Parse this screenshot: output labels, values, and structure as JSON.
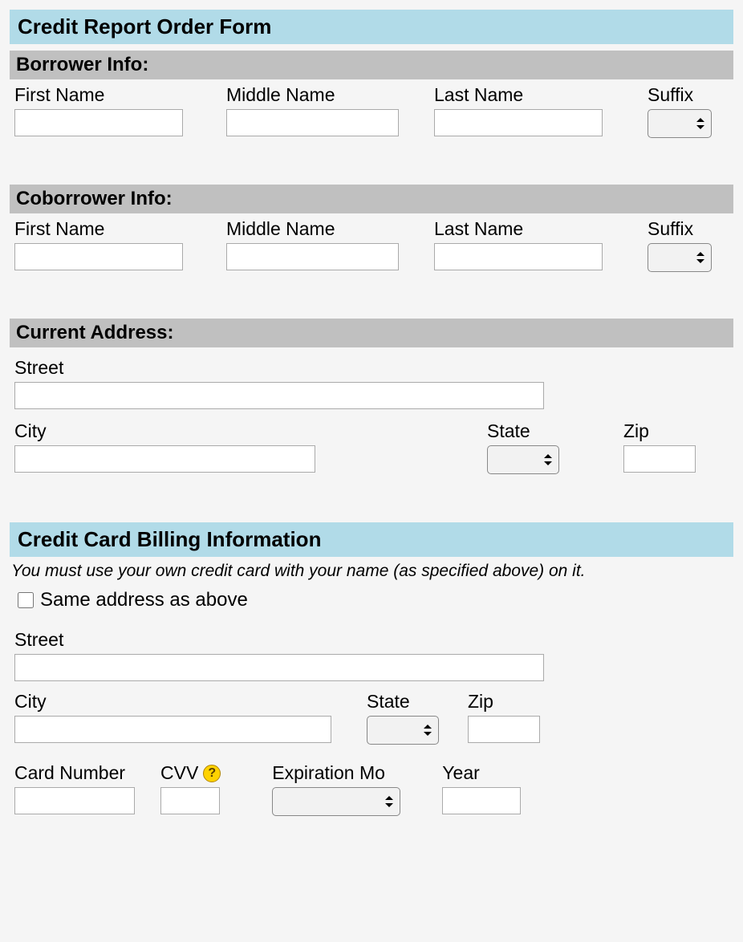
{
  "title": "Credit Report Order Form",
  "borrower": {
    "heading": "Borrower Info:",
    "first_name_label": "First Name",
    "middle_name_label": "Middle Name",
    "last_name_label": "Last Name",
    "suffix_label": "Suffix"
  },
  "coborrower": {
    "heading": "Coborrower Info:",
    "first_name_label": "First Name",
    "middle_name_label": "Middle Name",
    "last_name_label": "Last Name",
    "suffix_label": "Suffix"
  },
  "address": {
    "heading": "Current Address:",
    "street_label": "Street",
    "city_label": "City",
    "state_label": "State",
    "zip_label": "Zip"
  },
  "billing": {
    "heading": "Credit Card Billing Information",
    "note": "You must use your own credit card with your name (as specified above) on it.",
    "same_address_label": "Same address as above",
    "street_label": "Street",
    "city_label": "City",
    "state_label": "State",
    "zip_label": "Zip",
    "card_number_label": "Card Number",
    "cvv_label": "CVV",
    "exp_month_label": "Expiration Mo",
    "year_label": "Year"
  }
}
